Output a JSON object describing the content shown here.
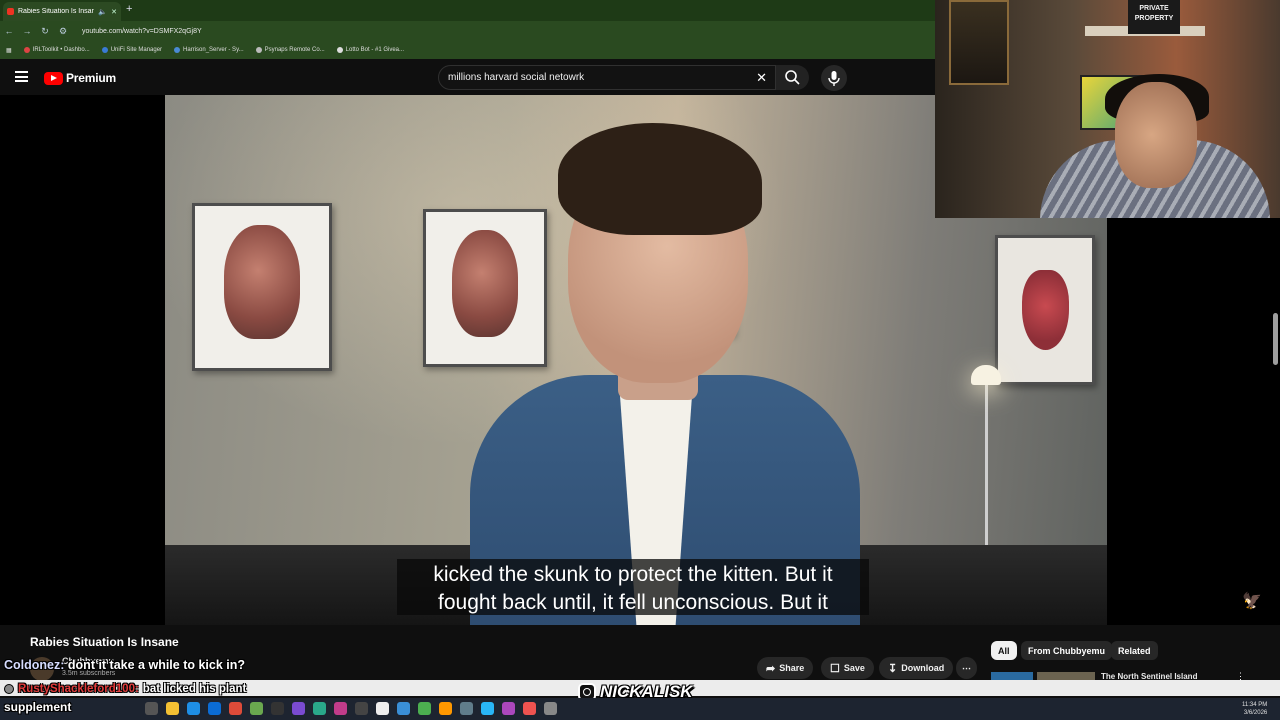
{
  "browser": {
    "tab_title": "Rabies Situation Is Insane",
    "url": "youtube.com/watch?v=DSMFX2qGj8Y",
    "bookmarks": [
      "IRLToolkit • Dashbo...",
      "UniFi Site Manager",
      "Harrison_Server - Sy...",
      "Psynaps Remote Co...",
      "Lotto Bot - #1 Givea..."
    ]
  },
  "youtube": {
    "brand": "Premium",
    "search_value": "millions harvard social netowrk",
    "caption_line1": "kicked the skunk to protect the kitten. But it",
    "caption_line2": "fought back until, it fell unconscious. But it",
    "video_title": "Rabies Situation Is Insane",
    "channel_name": "Chubbyemu",
    "subscribers": "3.5m subscribers",
    "actions": {
      "share": "Share",
      "save": "Save",
      "download": "Download"
    },
    "chips": [
      "All",
      "From Chubbyemu",
      "Related"
    ],
    "rec_title": "The North Sentinel Island"
  },
  "stream": {
    "chat": [
      {
        "user": "Coldonez:",
        "msg": "dont it take a while to kick in?"
      },
      {
        "user": "RustyShackleford100:",
        "msg": "bat licked his plant"
      }
    ],
    "chat_cont": "supplement",
    "ig_handle": "NICKALISK"
  },
  "cam_sign": "PRIVATE PROPERTY",
  "taskbar": {
    "time": "11:34 PM",
    "date": "3/6/2026"
  },
  "colors": {
    "yt_red": "#ff0000",
    "chrome_green": "#2a4a20",
    "chat_user_red": "#e13a3a"
  }
}
